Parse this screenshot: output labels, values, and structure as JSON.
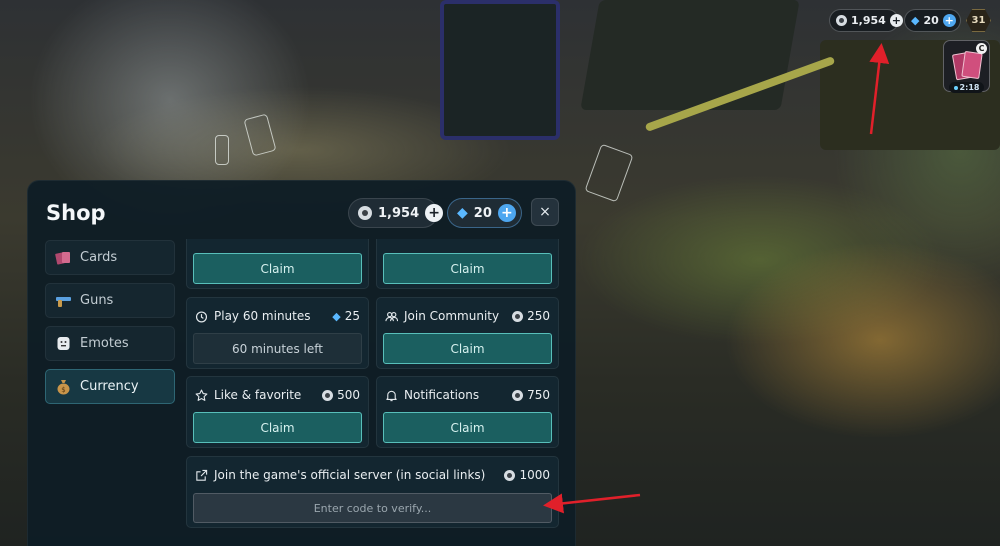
{
  "hud": {
    "coins": "1,954",
    "gems": "20",
    "level": "31",
    "card_badge": "C",
    "card_timer": "2:18"
  },
  "shop": {
    "title": "Shop",
    "coins": "1,954",
    "gems": "20",
    "close_label": "×",
    "sidebar": [
      {
        "label": "Cards",
        "icon": "cards-icon"
      },
      {
        "label": "Guns",
        "icon": "gun-icon"
      },
      {
        "label": "Emotes",
        "icon": "emote-icon"
      },
      {
        "label": "Currency",
        "icon": "money-bag-icon",
        "active": true
      }
    ],
    "tasks": {
      "top_left": {
        "button": "Claim"
      },
      "top_right": {
        "button": "Claim"
      },
      "play": {
        "label": "Play 60 minutes",
        "reward": "25",
        "reward_type": "gem",
        "button": "60 minutes left"
      },
      "community": {
        "label": "Join Community",
        "reward": "250",
        "reward_type": "coin",
        "button": "Claim"
      },
      "like": {
        "label": "Like & favorite",
        "reward": "500",
        "reward_type": "coin",
        "button": "Claim"
      },
      "notifications": {
        "label": "Notifications",
        "reward": "750",
        "reward_type": "coin",
        "button": "Claim"
      },
      "server": {
        "label": "Join the game's official server (in social links)",
        "reward": "1000",
        "reward_type": "coin",
        "placeholder": "Enter code to verify..."
      }
    }
  },
  "colors": {
    "panel": "#0e1d25",
    "claim": "#1b5f60",
    "claim_border": "#58bfba",
    "gem": "#5ab8ff",
    "arrow": "#e0202a"
  }
}
